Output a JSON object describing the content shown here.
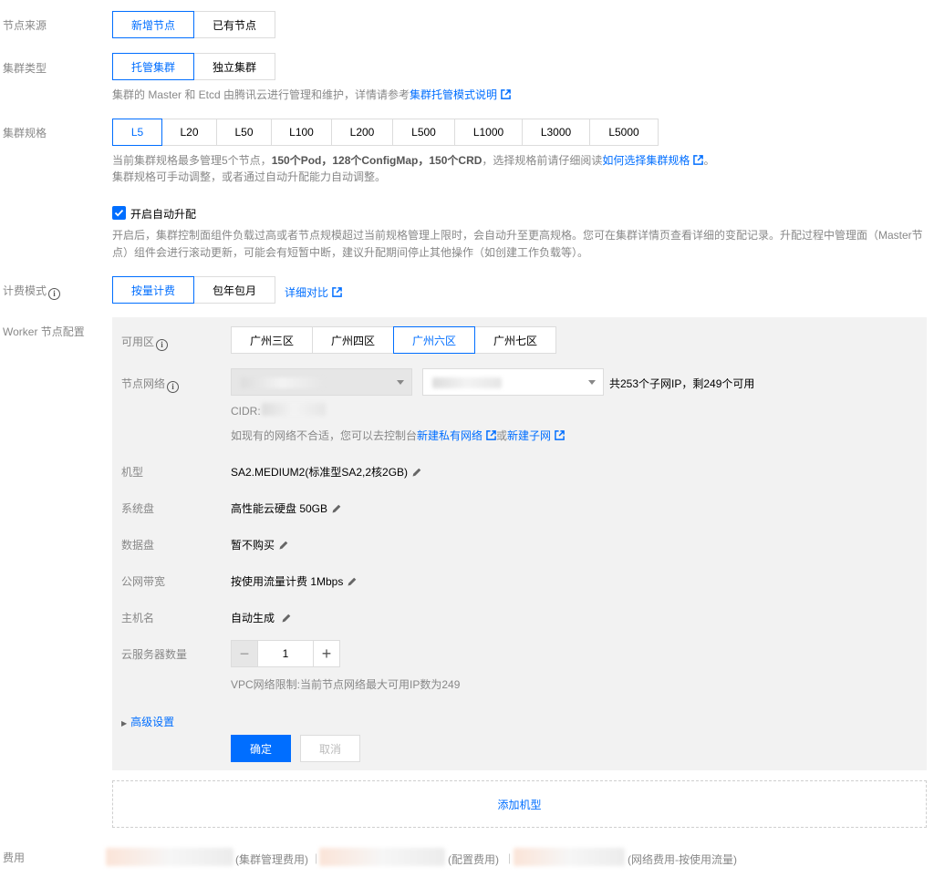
{
  "node_source": {
    "label": "节点来源",
    "options": [
      "新增节点",
      "已有节点"
    ],
    "selected": "新增节点"
  },
  "cluster_type": {
    "label": "集群类型",
    "options": [
      "托管集群",
      "独立集群"
    ],
    "selected": "托管集群",
    "hint_prefix": "集群的 Master 和 Etcd 由腾讯云进行管理和维护，详情请参考",
    "hint_link": "集群托管模式说明"
  },
  "cluster_spec": {
    "label": "集群规格",
    "options": [
      "L5",
      "L20",
      "L50",
      "L100",
      "L200",
      "L500",
      "L1000",
      "L3000",
      "L5000"
    ],
    "selected": "L5",
    "hint_1": "当前集群规格最多管理5个节点，",
    "hint_2": "150个Pod，128个ConfigMap，150个CRD",
    "hint_3": "，选择规格前请仔细阅读",
    "hint_link": "如何选择集群规格",
    "hint_4": "。",
    "hint_line2": "集群规格可手动调整，或者通过自动升配能力自动调整。"
  },
  "auto_upgrade": {
    "label": "开启自动升配",
    "checked": true,
    "desc_1": "开启后，集群控制面组件负载过高或者节点规模超过当前规格管理上限时，会自动升至更高规格。您可在集群详情页查看详细的变配记录。升配过程中管理面（Master节",
    "desc_2": "点）组件会进行滚动更新，可能会有短暂中断，建议升配期间停止其他操作（如创建工作负载等）。"
  },
  "billing": {
    "label": "计费模式",
    "options": [
      "按量计费",
      "包年包月"
    ],
    "selected": "按量计费",
    "compare_link": "详细对比"
  },
  "worker": {
    "label": "Worker 节点配置",
    "zone_label": "可用区",
    "zones": [
      "广州三区",
      "广州四区",
      "广州六区",
      "广州七区"
    ],
    "zone_selected": "广州六区",
    "network_label": "节点网络",
    "subnet_info": "共253个子网IP，剩249个可用",
    "cidr_label": "CIDR:",
    "network_hint": "如现有的网络不合适，您可以去控制台",
    "new_vpc_link": "新建私有网络",
    "or_text": "或",
    "new_subnet_link": "新建子网",
    "model_label": "机型",
    "model_value": "SA2.MEDIUM2(标准型SA2,2核2GB)",
    "sysdisk_label": "系统盘",
    "sysdisk_value": "高性能云硬盘 50GB",
    "datadisk_label": "数据盘",
    "datadisk_value": "暂不购买",
    "bandwidth_label": "公网带宽",
    "bandwidth_value": "按使用流量计费 1Mbps",
    "hostname_label": "主机名",
    "hostname_value": "自动生成",
    "count_label": "云服务器数量",
    "count_value": "1",
    "count_minus": "−",
    "count_plus": "+",
    "vpc_limit": "VPC网络限制:当前节点网络最大可用IP数为249",
    "advanced": "高级设置",
    "confirm": "确定",
    "cancel": "取消"
  },
  "add_model": "添加机型",
  "cost": {
    "label": "费用",
    "item_1": "(集群管理费用)",
    "item_2": "(配置费用)",
    "item_3": "(网络费用-按使用流量)",
    "sep": "|"
  },
  "colors": {
    "accent": "#006eff",
    "panel_bg": "#f2f2f2",
    "muted_text": "#888888"
  }
}
